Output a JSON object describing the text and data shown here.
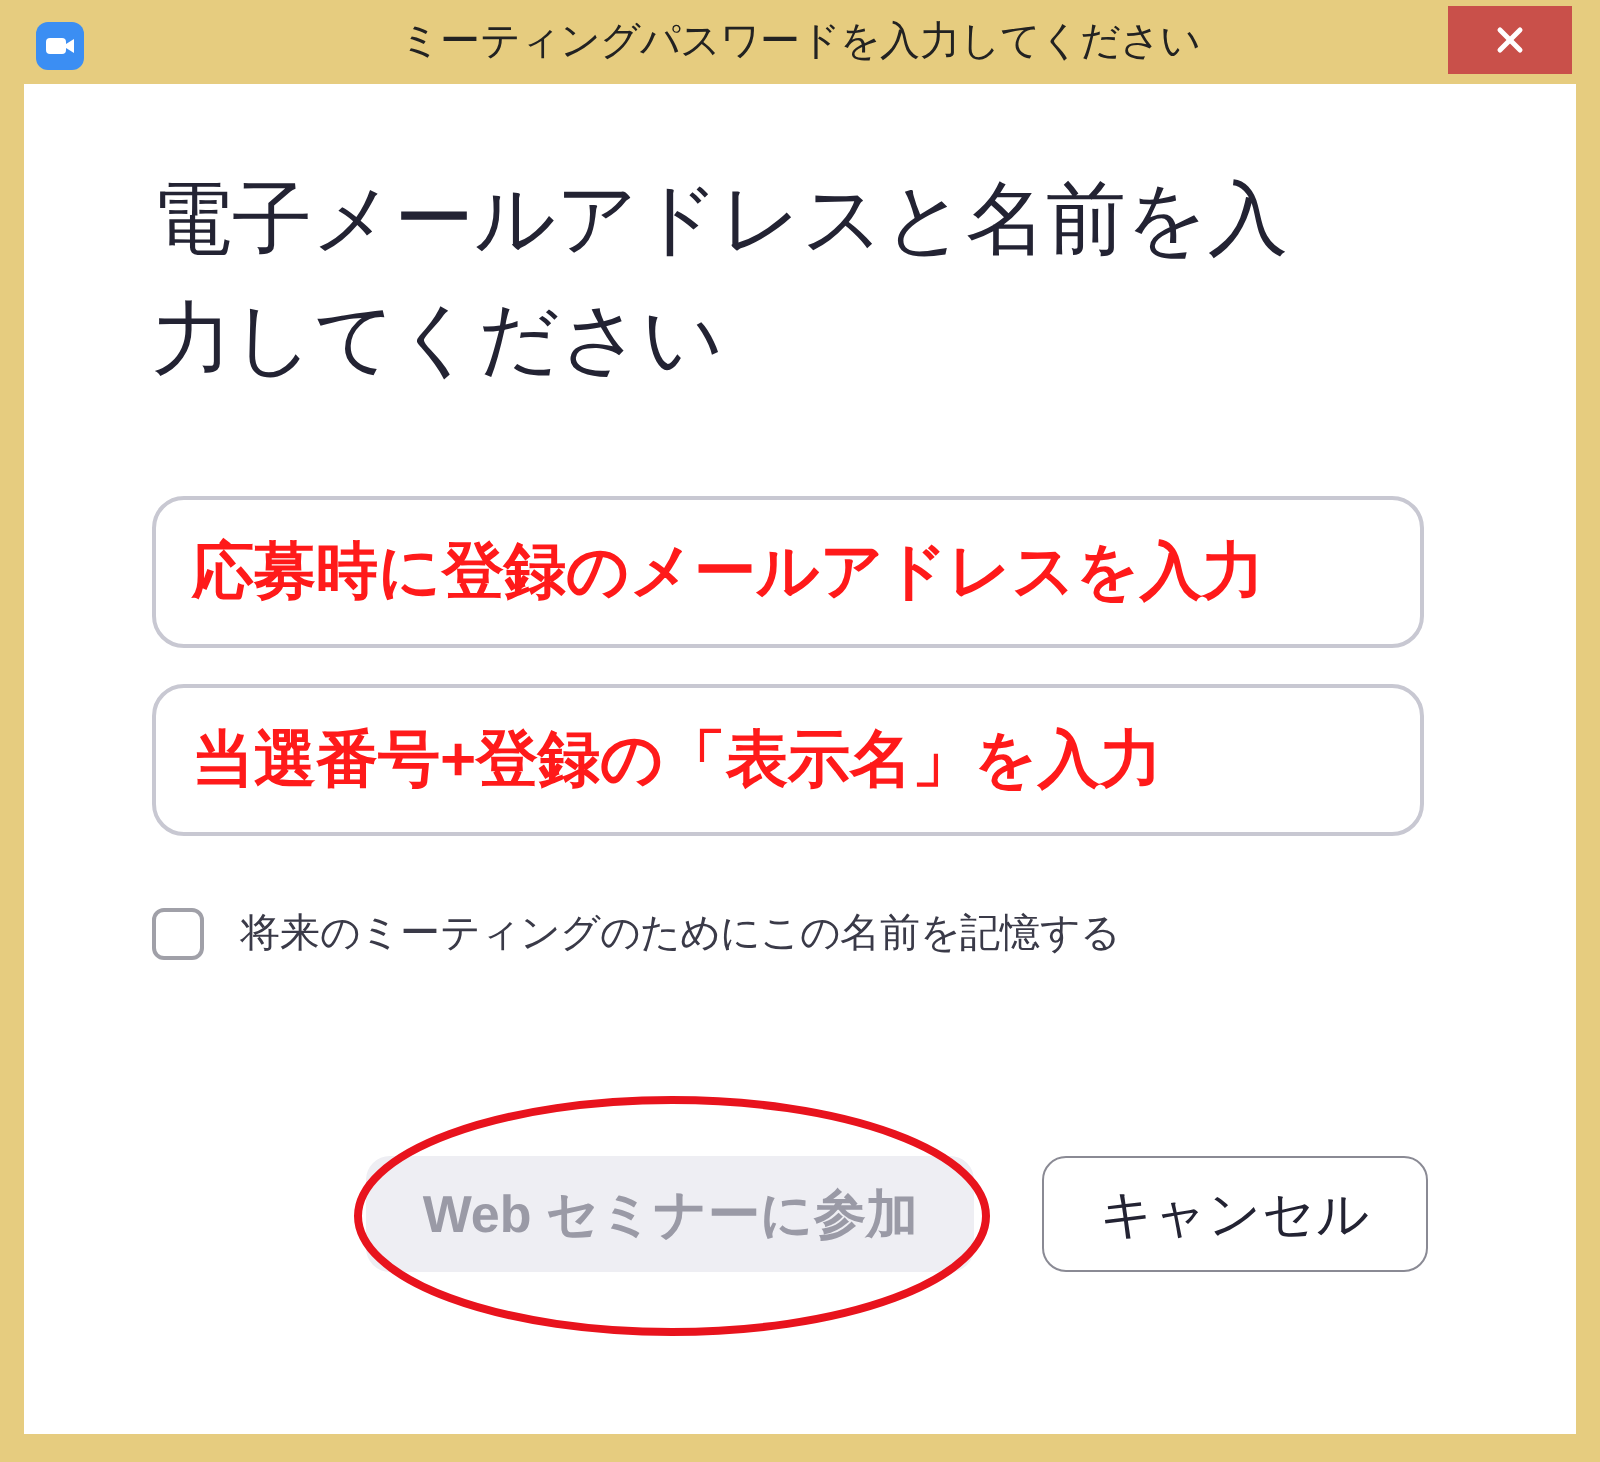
{
  "window": {
    "title": "ミーティングパスワードを入力してください"
  },
  "heading": "電子メールアドレスと名前を入力してください",
  "fields": [
    {
      "value": "応募時に登録のメールアドレスを入力"
    },
    {
      "value": "当選番号+登録の「表示名」を入力"
    }
  ],
  "remember": {
    "label": "将来のミーティングのためにこの名前を記憶する",
    "checked": false
  },
  "buttons": [
    {
      "label": "Web セミナーに参加",
      "disabled": true,
      "highlighted": true
    },
    {
      "label": "キャンセル",
      "disabled": false,
      "highlighted": false
    }
  ]
}
